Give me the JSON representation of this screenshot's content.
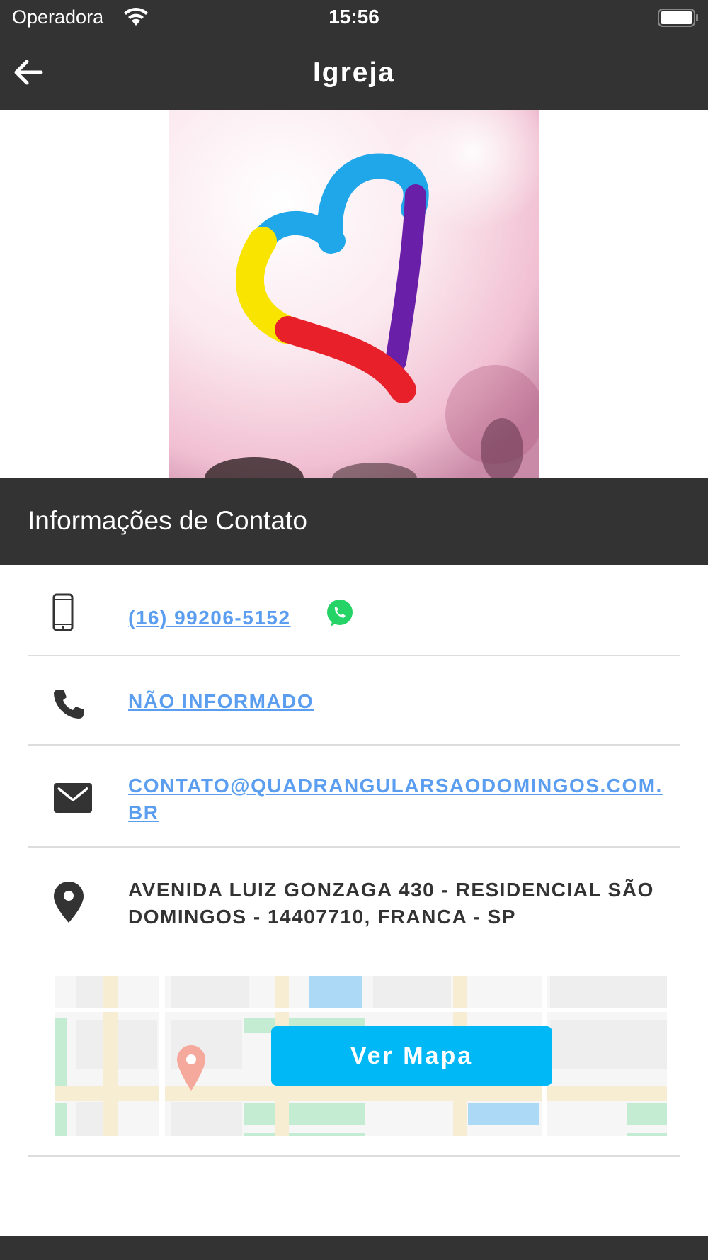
{
  "status_bar": {
    "carrier": "Operadora",
    "time": "15:56"
  },
  "nav": {
    "title": "Igreja"
  },
  "section": {
    "title": "Informações de Contato"
  },
  "contacts": {
    "mobile": "(16) 99206-5152",
    "phone": "NÃO INFORMADO",
    "email_line1": "CONTATO@QUADRANGULARSAODOMINGOS.COM.",
    "email_line2": "BR",
    "address_line1": "AVENIDA LUIZ GONZAGA 430 - RESIDENCIAL SÃO",
    "address_line2": "DOMINGOS - 14407710, FRANCA - SP"
  },
  "map": {
    "button_label": "Ver Mapa"
  },
  "colors": {
    "bar_background": "#333333",
    "link": "#5b9ef0",
    "map_button": "#00b8f5",
    "whatsapp": "#25d366"
  }
}
